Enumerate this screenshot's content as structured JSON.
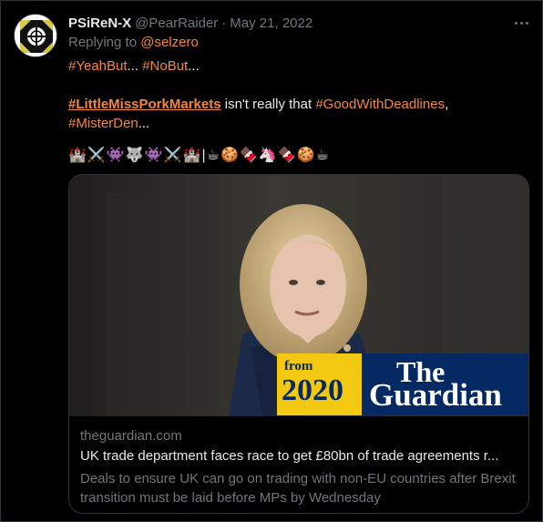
{
  "tweet": {
    "display_name": "PSiReN-X",
    "handle": "@PearRaider",
    "separator": "·",
    "date": "May 21, 2022",
    "replying_to_prefix": "Replying to",
    "replying_to_user": "@selzero",
    "body": {
      "line1_tag1": "#YeahBut",
      "line1_text1": "... ",
      "line1_tag2": "#NoBut",
      "line1_text2": "...",
      "line2_tag1": "#LittleMissPorkMarkets",
      "line2_text1": " isn't really that ",
      "line2_tag2": "#GoodWithDeadlines",
      "line2_text2": ",",
      "line3_tag1": "#MisterDen",
      "line3_text1": "..."
    },
    "emojis": "🏰⚔️👾🐺👾⚔️🏰|☕🍪🍫🦄🍫🍪☕"
  },
  "card": {
    "badge_from": "from",
    "badge_year": "2020",
    "brand_the": "The",
    "brand_guardian": "Guardian",
    "domain": "theguardian.com",
    "title": "UK trade department faces race to get £80bn of trade agreements r...",
    "description": "Deals to ensure UK can go on trading with non-EU countries after Brexit transition must be laid before MPs by Wednesday"
  },
  "icons": {
    "more": "more-icon",
    "avatar": "crosshair-avatar"
  },
  "colors": {
    "background": "#000000",
    "text": "#e7e9ea",
    "muted": "#71767b",
    "hashtag": "#f4873a",
    "border": "#2f3336",
    "guardian_blue": "#052962",
    "guardian_yellow": "#f2c811"
  }
}
